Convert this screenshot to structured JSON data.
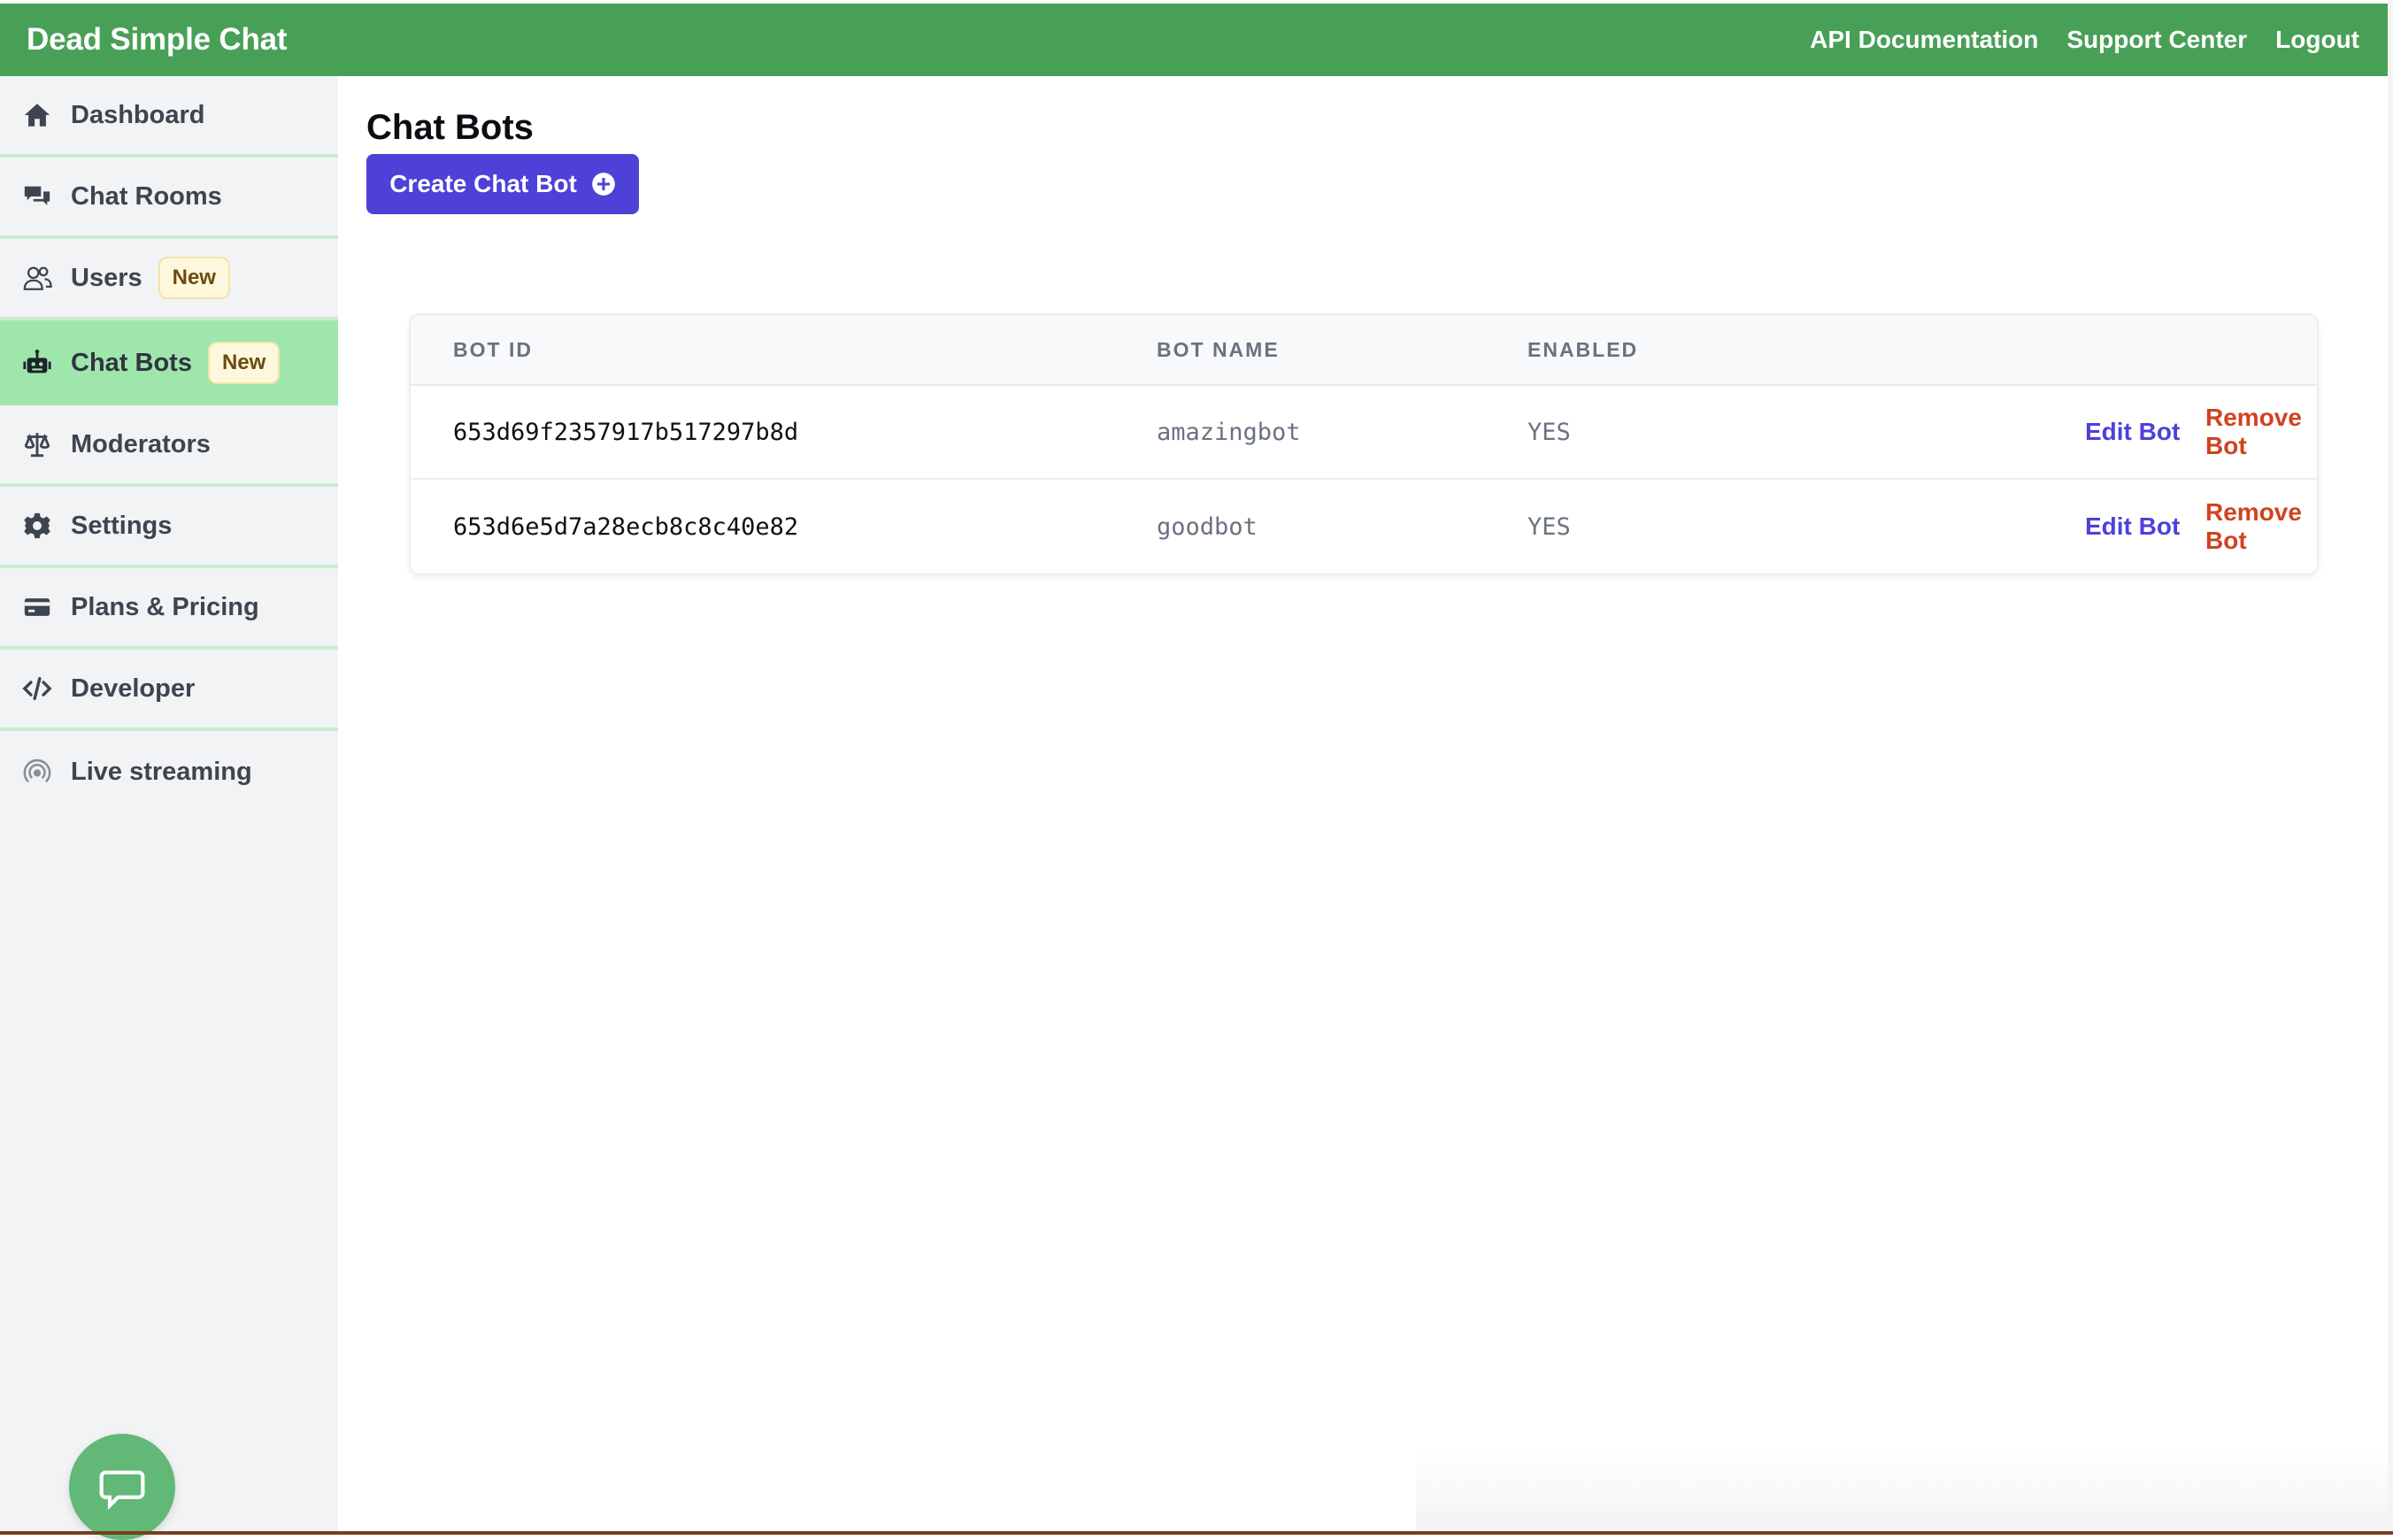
{
  "app": {
    "brand": "Dead Simple Chat",
    "top_links": [
      "API Documentation",
      "Support Center",
      "Logout"
    ]
  },
  "sidebar": {
    "items": [
      {
        "label": "Dashboard",
        "icon": "home-icon"
      },
      {
        "label": "Chat Rooms",
        "icon": "chat-bubbles-icon"
      },
      {
        "label": "Users",
        "icon": "users-icon",
        "badge": "New"
      },
      {
        "label": "Chat Bots",
        "icon": "robot-icon",
        "badge": "New",
        "active": true
      },
      {
        "label": "Moderators",
        "icon": "scales-icon"
      },
      {
        "label": "Settings",
        "icon": "gear-icon"
      },
      {
        "label": "Plans & Pricing",
        "icon": "credit-card-icon"
      },
      {
        "label": "Developer",
        "icon": "code-icon"
      },
      {
        "label": "Live streaming",
        "icon": "broadcast-icon"
      }
    ],
    "chat_fab_icon": "chat-bubble-icon"
  },
  "main": {
    "title": "Chat Bots",
    "create_button": "Create Chat Bot",
    "create_icon": "plus-circle-icon",
    "table": {
      "headers": [
        "BOT ID",
        "BOT NAME",
        "ENABLED"
      ],
      "rows": [
        {
          "id": "653d69f2357917b517297b8d",
          "name": "amazingbot",
          "enabled": "YES",
          "edit": "Edit Bot",
          "remove": "Remove Bot"
        },
        {
          "id": "653d6e5d7a28ecb8c8c40e82",
          "name": "goodbot",
          "enabled": "YES",
          "edit": "Edit Bot",
          "remove": "Remove Bot"
        }
      ]
    }
  },
  "colors": {
    "topbar": "#48a056",
    "active_nav": "#9fe6ac",
    "primary_button": "#4d41d8",
    "remove_link": "#d0421f"
  }
}
